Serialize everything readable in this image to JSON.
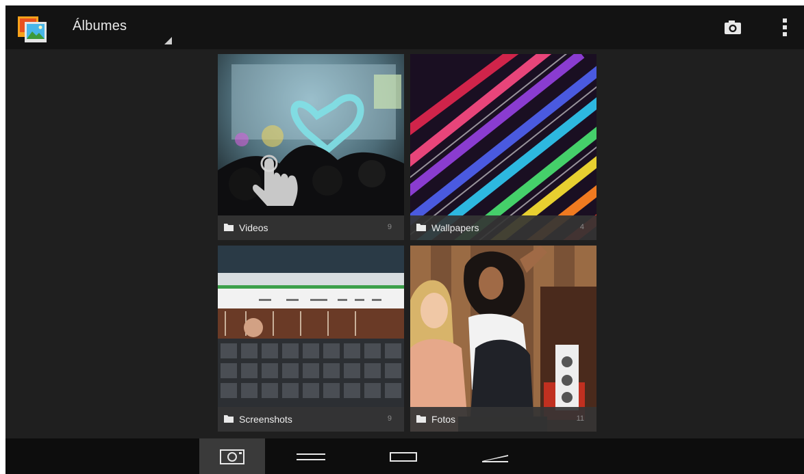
{
  "actionbar": {
    "title": "Álbumes",
    "app_icon": "gallery-icon",
    "camera_icon": "camera-icon",
    "overflow_icon": "overflow-menu-icon"
  },
  "albums": [
    {
      "name": "Videos",
      "count": "9",
      "icon": "folder-icon"
    },
    {
      "name": "Wallpapers",
      "count": "4",
      "icon": "folder-icon"
    },
    {
      "name": "Screenshots",
      "count": "9",
      "icon": "folder-icon"
    },
    {
      "name": "Fotos",
      "count": "11",
      "icon": "folder-icon"
    }
  ],
  "bottom_tabs": [
    {
      "icon": "camera-view-icon",
      "selected": true
    },
    {
      "icon": "list-view-icon",
      "selected": false
    },
    {
      "icon": "frame-view-icon",
      "selected": false
    },
    {
      "icon": "filmstrip-view-icon",
      "selected": false
    }
  ],
  "colors": {
    "background": "#1f1f1f",
    "actionbar": "#131313",
    "label_bar": "#343434",
    "text": "#ededed"
  }
}
